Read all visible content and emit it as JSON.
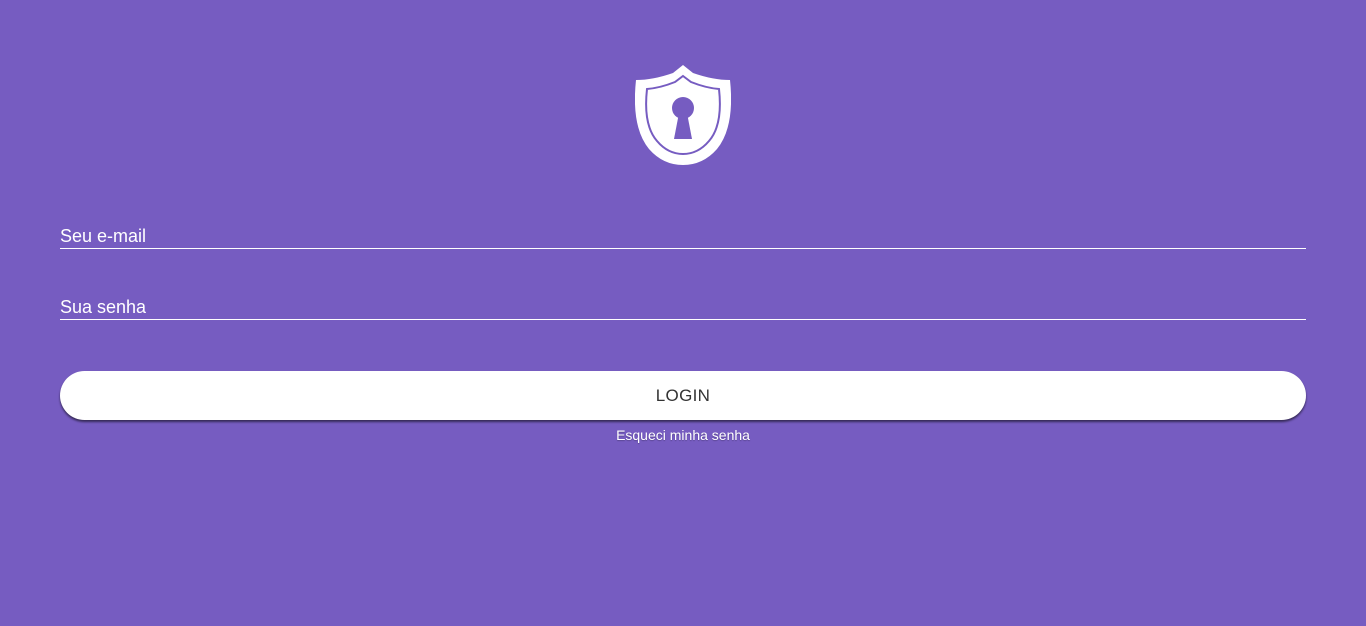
{
  "theme": {
    "background": "#765cc1",
    "button_background": "#ffffff",
    "button_text": "#333333",
    "text": "#ffffff"
  },
  "logo": {
    "icon": "shield-keyhole-icon"
  },
  "form": {
    "email_placeholder": "Seu e-mail",
    "email_value": "",
    "password_placeholder": "Sua senha",
    "password_value": "",
    "login_label": "LOGIN",
    "forgot_password_label": "Esqueci minha senha"
  }
}
